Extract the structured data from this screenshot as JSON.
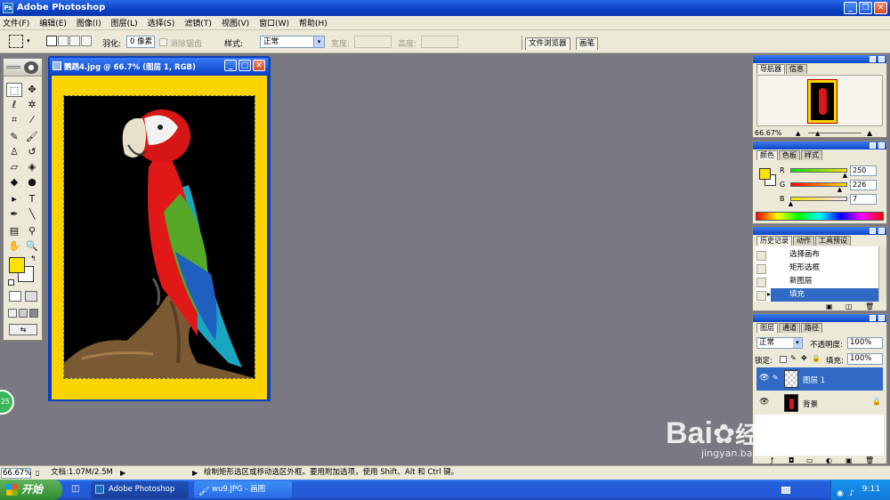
{
  "app": {
    "title": "Adobe Photoshop",
    "logo_text": "Ps"
  },
  "window_controls": {
    "minimize": "_",
    "restore": "❐",
    "close": "✕"
  },
  "menu": [
    "文件(F)",
    "编辑(E)",
    "图像(I)",
    "图层(L)",
    "选择(S)",
    "滤镜(T)",
    "视图(V)",
    "窗口(W)",
    "帮助(H)"
  ],
  "options": {
    "feather_label": "羽化:",
    "feather_value": "0 像素",
    "antialias_label": "消除锯齿",
    "style_label": "样式:",
    "style_value": "正常",
    "width_label": "宽度:",
    "height_label": "高度:",
    "tab_file_browser": "文件浏览器",
    "tab_brushes": "画笔"
  },
  "document": {
    "title": "鹦鹉4.jpg @ 66.7% (图层 1, RGB)",
    "canvas_color": "#fad400"
  },
  "colors": {
    "foreground": "#fae207",
    "background": "#ffffff"
  },
  "navigator": {
    "tabs": [
      "导航器",
      "信息"
    ],
    "zoom": "66.67%"
  },
  "color_panel": {
    "tabs": [
      "颜色",
      "色板",
      "样式"
    ],
    "r_label": "R",
    "r_value": "250",
    "r_fraction": 0.98,
    "g_label": "G",
    "g_value": "226",
    "g_fraction": 0.886,
    "b_label": "B",
    "b_value": "7",
    "b_fraction": 0.027
  },
  "history": {
    "tabs": [
      "历史记录",
      "动作",
      "工具预设"
    ],
    "items": [
      "选择画布",
      "矩形选框",
      "新图层",
      "填充"
    ]
  },
  "layers": {
    "tabs": [
      "图层",
      "通道",
      "路径"
    ],
    "blend_mode": "正常",
    "opacity_label": "不透明度:",
    "opacity_value": "100%",
    "lock_label": "锁定:",
    "fill_label": "填充:",
    "fill_value": "100%",
    "items": [
      "图层 1",
      "背景"
    ]
  },
  "status": {
    "zoom": "66.67%",
    "doc_info": "文档:1.07M/2.5M",
    "hint": "绘制矩形选区或移动选区外框。要用附加选项，使用 Shift、Alt 和 Ctrl 键。"
  },
  "taskbar": {
    "start": "开始",
    "tasks": [
      "Adobe Photoshop",
      "wu9.JPG - 画图"
    ],
    "time": "9:11"
  },
  "watermark": {
    "brand": "Bai",
    "brand2": "经验",
    "url": "jingyan.baidu.com"
  },
  "side_badge": "25"
}
